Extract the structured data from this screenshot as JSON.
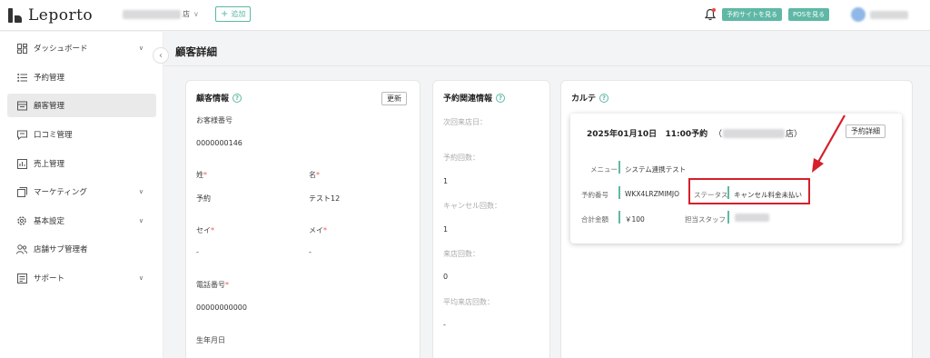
{
  "header": {
    "logo_text": "Leporto",
    "store_suffix": "店",
    "add_label": "追加",
    "view_site_label": "予約サイトを見る",
    "pos_label": "POSを見る"
  },
  "sidebar": {
    "items": [
      {
        "label": "ダッシュボード",
        "icon": "dashboard-icon"
      },
      {
        "label": "予約管理",
        "icon": "list-icon"
      },
      {
        "label": "顧客管理",
        "icon": "customer-icon"
      },
      {
        "label": "口コミ管理",
        "icon": "comment-icon"
      },
      {
        "label": "売上管理",
        "icon": "chart-icon"
      },
      {
        "label": "マーケティング",
        "icon": "marketing-icon"
      },
      {
        "label": "基本設定",
        "icon": "gear-icon"
      },
      {
        "label": "店舗サブ管理者",
        "icon": "users-icon"
      },
      {
        "label": "サポート",
        "icon": "support-icon"
      }
    ]
  },
  "page": {
    "title": "顧客詳細"
  },
  "customer": {
    "title": "顧客情報",
    "update_label": "更新",
    "number_label": "お客様番号",
    "number": "0000000146",
    "last_name_label": "姓",
    "first_name_label": "名",
    "last_name": "予約",
    "first_name": "テスト12",
    "last_kana_label": "セイ",
    "first_kana_label": "メイ",
    "last_kana": "-",
    "first_kana": "-",
    "phone_label": "電話番号",
    "phone": "00000000000",
    "birthday_label": "生年月日",
    "required_mark": "*"
  },
  "reservation_info": {
    "title": "予約関連情報",
    "next_visit_label": "次回来店日：",
    "reservation_count_label": "予約回数：",
    "reservation_count": "1",
    "cancel_count_label": "キャンセル回数：",
    "cancel_count": "1",
    "visit_count_label": "来店回数：",
    "visit_count": "0",
    "avg_visit_label": "平均来店回数：",
    "avg_visit": "-"
  },
  "karte": {
    "title": "カルテ",
    "date": "2025年01月10日",
    "time": "11:00予約",
    "open_paren": "（",
    "store_suffix": "店）",
    "detail_label": "予約詳細",
    "menu_label": "メニュー",
    "menu_value": "システム連携テスト",
    "res_no_label": "予約番号",
    "res_no_value": "WKX4LRZMIMJO",
    "status_label": "ステータス",
    "status_value": "キャンセル料金未払い",
    "total_label": "合計金額",
    "total_value": "￥100",
    "staff_label": "担当スタッフ"
  },
  "colors": {
    "accent": "#5fb8a5",
    "highlight": "#d61f2a"
  }
}
